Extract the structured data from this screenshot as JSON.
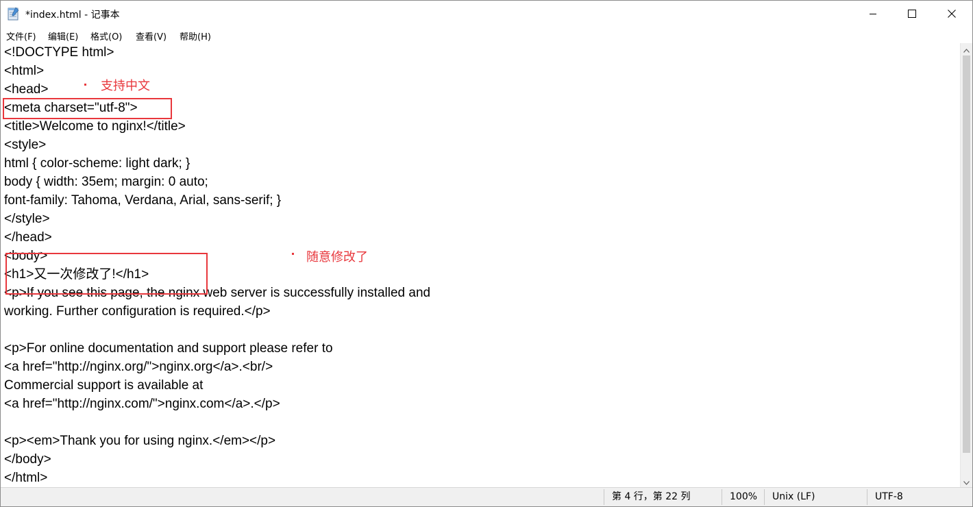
{
  "window": {
    "title": "*index.html - 记事本"
  },
  "menu": [
    {
      "label": "文件(F)"
    },
    {
      "label": "编辑(E)"
    },
    {
      "label": "格式(O)"
    },
    {
      "label": "查看(V)"
    },
    {
      "label": "帮助(H)"
    }
  ],
  "editor": {
    "lines": [
      "<!DOCTYPE html>",
      "<html>",
      "<head>",
      "<meta charset=\"utf-8\">",
      "<title>Welcome to nginx!</title>",
      "<style>",
      "html { color-scheme: light dark; }",
      "body { width: 35em; margin: 0 auto;",
      "font-family: Tahoma, Verdana, Arial, sans-serif; }",
      "</style>",
      "</head>",
      "<body>",
      "<h1>又一次修改了!</h1>",
      "<p>If you see this page, the nginx web server is successfully installed and",
      "working. Further configuration is required.</p>",
      "",
      "<p>For online documentation and support please refer to",
      "<a href=\"http://nginx.org/\">nginx.org</a>.<br/>",
      "Commercial support is available at",
      "<a href=\"http://nginx.com/\">nginx.com</a>.</p>",
      "",
      "<p><em>Thank you for using nginx.</em></p>",
      "</body>",
      "</html>"
    ]
  },
  "annotations": {
    "note_charset": "支持中文",
    "note_modified": "随意修改了",
    "color": "#e8373c"
  },
  "status": {
    "position": "第 4 行，第 22 列",
    "zoom": "100%",
    "line_ending": "Unix (LF)",
    "encoding": "UTF-8"
  },
  "icons": {
    "app": "notepad-icon",
    "minimize": "minimize-icon",
    "maximize": "maximize-icon",
    "close": "close-icon",
    "scroll_up": "chevron-up-icon",
    "scroll_down": "chevron-down-icon"
  }
}
